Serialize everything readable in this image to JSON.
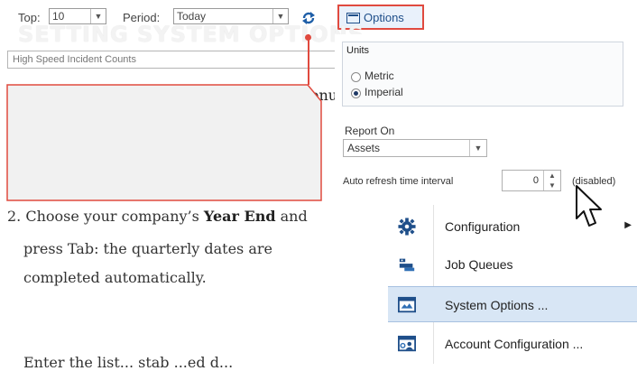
{
  "toolbar": {
    "top_label": "Top:",
    "top_value": "10",
    "period_label": "Period:",
    "period_value": "Today",
    "options_label": "Options"
  },
  "faded_heading": "SETTING SYSTEM OPTIONS",
  "search_field_value": "High Speed Incident Counts",
  "menu_fragment": "enu",
  "options_panel": {
    "units_title": "Units",
    "metric_label": "Metric",
    "imperial_label": "Imperial",
    "selected_unit": "Imperial",
    "report_on_label": "Report On",
    "report_on_value": "Assets",
    "auto_refresh_label": "Auto refresh time interval",
    "auto_refresh_value": "0",
    "auto_refresh_status": "(disabled)"
  },
  "context_menu": {
    "items": [
      {
        "label": "Configuration",
        "icon": "gear-icon",
        "has_submenu": true
      },
      {
        "label": "Job Queues",
        "icon": "job-queue-icon"
      },
      {
        "label": "System Options ...",
        "icon": "system-options-icon",
        "selected": true
      },
      {
        "label": "Account Configuration ...",
        "icon": "account-config-icon"
      }
    ]
  },
  "document": {
    "step2_prefix": "2. Choose your company’s ",
    "step2_bold": "Year End",
    "step2_suffix": " and",
    "step2_line2": "press Tab: the quarterly dates are",
    "step2_line3": "completed automatically.",
    "step3_partial": "Enter the list... stab ...ed d..."
  },
  "colors": {
    "highlight_red": "#e04a3f",
    "menu_selected": "#d8e6f5",
    "icon_blue": "#1f4f8a"
  }
}
